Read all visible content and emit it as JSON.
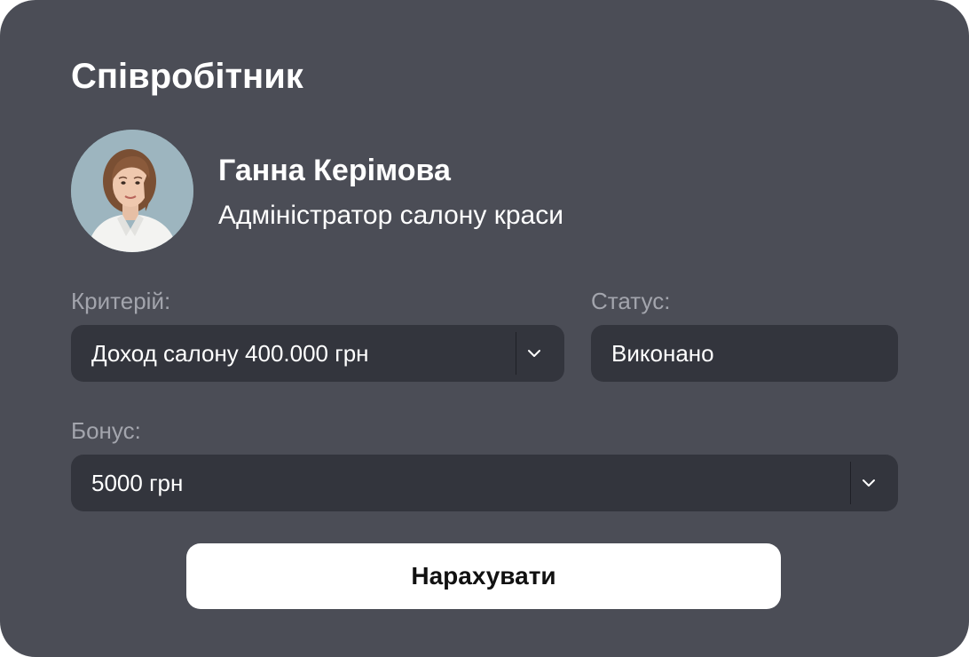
{
  "card": {
    "title": "Співробітник"
  },
  "employee": {
    "name": "Ганна Керімова",
    "role": "Адміністратор салону краси",
    "avatar": "employee-photo"
  },
  "criterion": {
    "label": "Критерій:",
    "value": "Доход салону 400.000 грн",
    "icon": "chevron-down-icon"
  },
  "status": {
    "label": "Статус:",
    "value": "Виконано"
  },
  "bonus": {
    "label": "Бонус:",
    "value": "5000 грн",
    "icon": "chevron-down-icon"
  },
  "actions": {
    "submit_label": "Нарахувати"
  },
  "colors": {
    "card_background": "#4b4d56",
    "field_background": "#33353d",
    "label_text": "#a3a5ad",
    "primary_text": "#ffffff",
    "button_background": "#ffffff",
    "button_text": "#111111"
  }
}
